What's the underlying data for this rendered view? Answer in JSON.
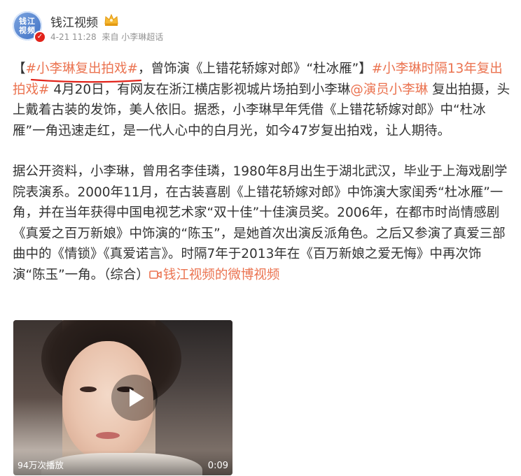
{
  "header": {
    "avatar_text_line1": "钱江",
    "avatar_text_line2": "视频",
    "author": "钱江视频",
    "date": "4-21 11:28",
    "source": "来自 小李琳超话"
  },
  "post": {
    "p1": {
      "bracket_open": "【",
      "hashtag1": "#小李琳复出拍戏#",
      "text1": "，曾饰演《上错花轿嫁对郎》“杜冰雁”】",
      "hashtag2": "#小李琳时隔13年复出拍戏#",
      "text2": " 4月20日，有网友在浙江横店影视城片场拍到小李琳",
      "mention": "@演员小李琳",
      "text3": " 复出拍摄，头上戴着古装的发饰，美人依旧。据悉，小李琳早年凭借《上错花轿嫁对郎》中“杜冰雁”一角迅速走红，是一代人心中的白月光，如今47岁复出拍戏，让人期待。"
    },
    "p2": {
      "text": "据公开资料，小李琳，曾用名李佳璘，1980年8月出生于湖北武汉，毕业于上海戏剧学院表演系。2000年11月，在古装喜剧《上错花轿嫁对郎》中饰演大家闺秀“杜冰雁”一角，并在当年获得中国电视艺术家“双十佳”十佳演员奖。2006年，在都市时尚情感剧《真爱之百万新娘》中饰演的“陈玉”，是她首次出演反派角色。之后又参演了真爱三部曲中的《情锁》《真爱诺言》。时隔7年于2013年在《百万新娘之爱无悔》中再次饰演“陈玉”一角。（综合）",
      "video_link": "钱江视频的微博视频"
    }
  },
  "video": {
    "views": "94万次播放",
    "duration": "0:09"
  },
  "colors": {
    "link": "#eb7350",
    "underline_mark": "#e2231a",
    "verified_badge": "#e2231a"
  },
  "icons": {
    "play": "play-icon",
    "video_link": "video-camera-icon",
    "crown": "crown-badge-icon",
    "verified": "verified-badge-icon"
  }
}
